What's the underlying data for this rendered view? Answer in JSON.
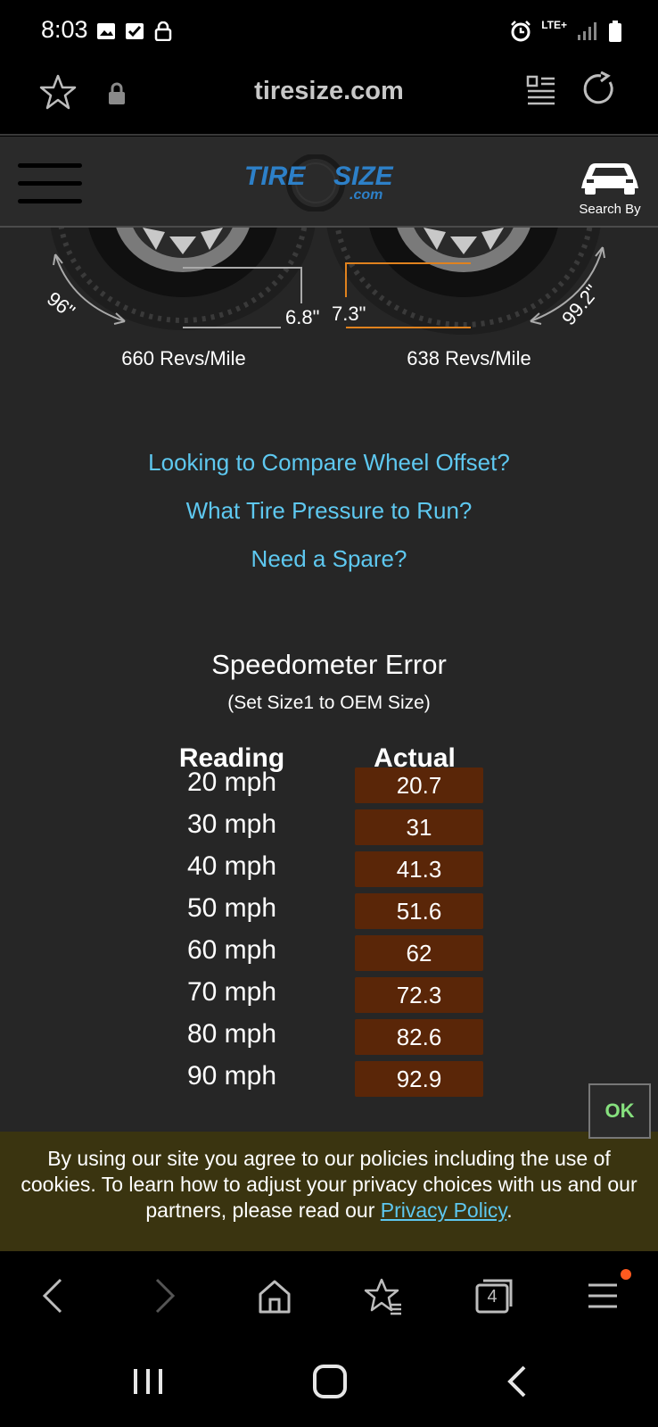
{
  "status_bar": {
    "time": "8:03",
    "network": "LTE+"
  },
  "browser": {
    "url": "tiresize.com"
  },
  "site_header": {
    "logo_text_top": "TIRE SIZE",
    "logo_text_bottom": ".com",
    "search_by_label": "Search By"
  },
  "tire_diagram": {
    "left_diameter": "96\"",
    "right_diameter": "99.2\"",
    "left_sidewall": "6.8\"",
    "right_sidewall": "7.3\"",
    "left_revs": "660 Revs/Mile",
    "right_revs": "638 Revs/Mile"
  },
  "links": [
    {
      "label": "Looking to Compare Wheel Offset?"
    },
    {
      "label": "What Tire Pressure to Run?"
    },
    {
      "label": "Need a Spare?"
    }
  ],
  "speedometer": {
    "title": "Speedometer Error",
    "subtitle": "(Set Size1 to OEM Size)",
    "col_reading": "Reading",
    "col_actual": "Actual",
    "rows": [
      {
        "reading": "20 mph",
        "actual": "20.7"
      },
      {
        "reading": "30 mph",
        "actual": "31"
      },
      {
        "reading": "40 mph",
        "actual": "41.3"
      },
      {
        "reading": "50 mph",
        "actual": "51.6"
      },
      {
        "reading": "60 mph",
        "actual": "62"
      },
      {
        "reading": "70 mph",
        "actual": "72.3"
      },
      {
        "reading": "80 mph",
        "actual": "82.6"
      },
      {
        "reading": "90 mph",
        "actual": "92.9"
      }
    ]
  },
  "cookie_banner": {
    "text": "By using our site you agree to our policies including the use of cookies. To learn how to adjust your privacy choices with us and our partners, please read our ",
    "link_label": "Privacy Policy",
    "end": ".",
    "ok_label": "OK"
  },
  "bottom_nav": {
    "tabs_count": "4"
  },
  "colors": {
    "link": "#5ec8f0",
    "actual_bg": "#5a2608",
    "ok_text": "#86e07e",
    "cookie_bg": "#3a3410",
    "tire_right_accent": "#e0821e"
  }
}
